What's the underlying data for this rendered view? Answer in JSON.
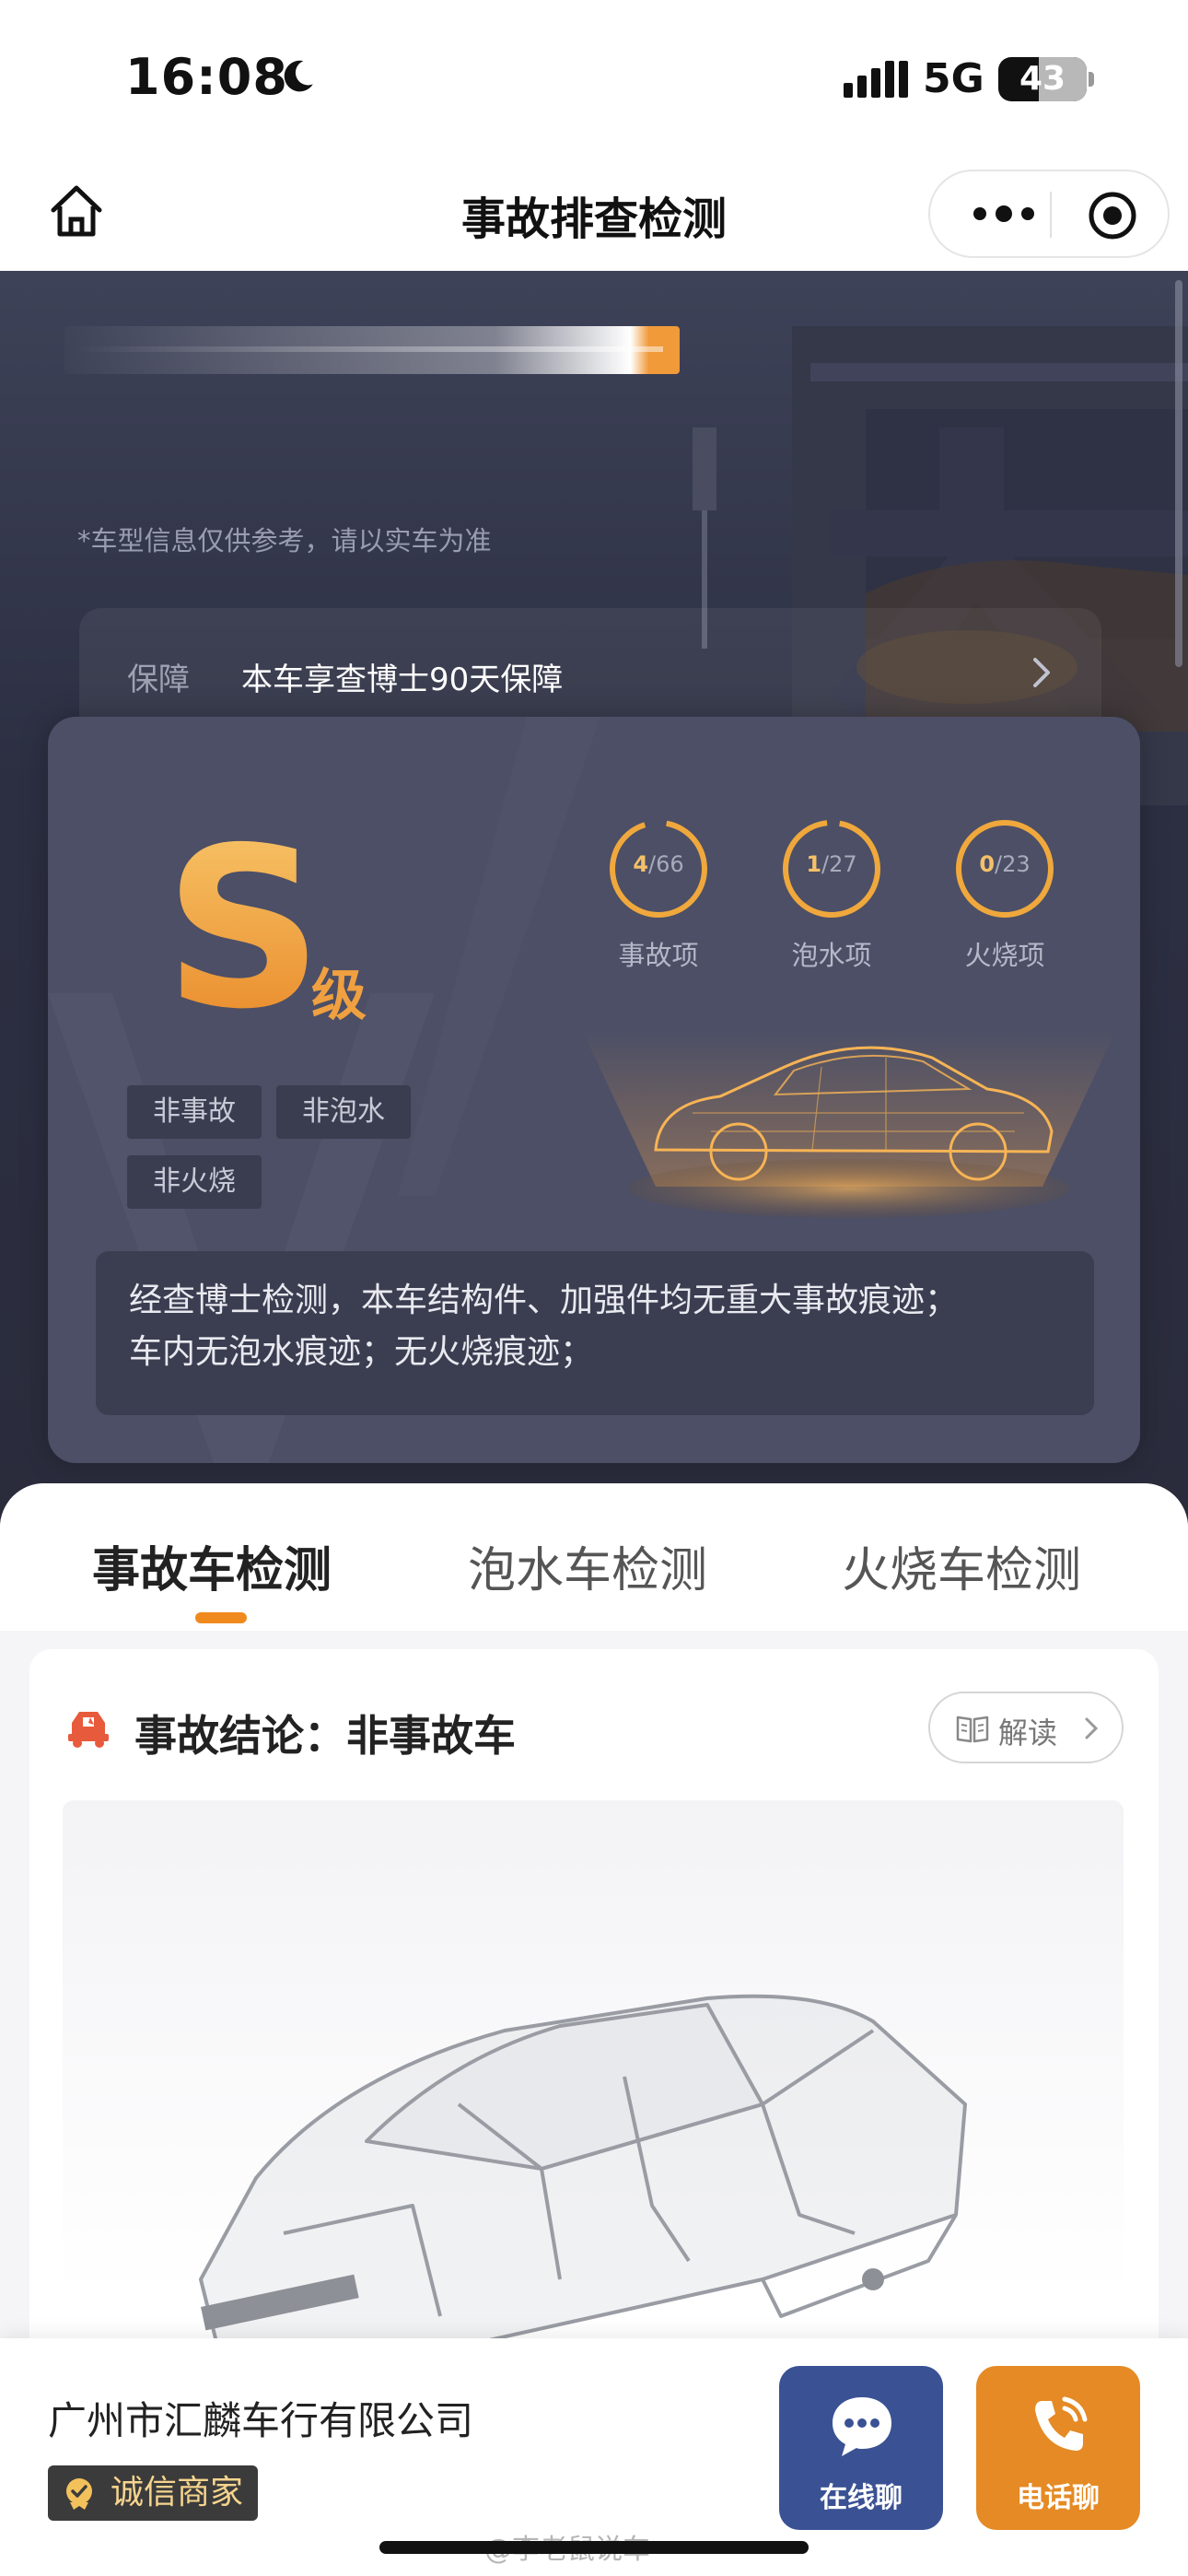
{
  "status_bar": {
    "time": "16:08",
    "network": "5G",
    "battery": "43"
  },
  "nav": {
    "title": "事故排查检测"
  },
  "hero": {
    "disclaimer": "*车型信息仅供参考，请以实车为准",
    "guarantee": {
      "label": "保障",
      "text": "本车享查博士90天保障"
    },
    "grade": {
      "letter": "S",
      "suffix": "级"
    },
    "tags": [
      "非事故",
      "非泡水",
      "非火烧"
    ],
    "stats": [
      {
        "count": "4",
        "total": "/66",
        "label": "事故项"
      },
      {
        "count": "1",
        "total": "/27",
        "label": "泡水项"
      },
      {
        "count": "0",
        "total": "/23",
        "label": "火烧项"
      }
    ],
    "summary_line1": "经查博士检测，本车结构件、加强件均无重大事故痕迹；",
    "summary_line2": "车内无泡水痕迹；无火烧痕迹；"
  },
  "tabs": [
    {
      "label": "事故车检测",
      "active": true
    },
    {
      "label": "泡水车检测",
      "active": false
    },
    {
      "label": "火烧车检测",
      "active": false
    }
  ],
  "result": {
    "title": "事故结论：非事故车",
    "read_label": "解读"
  },
  "bottom_bar": {
    "company": "广州市汇麟车行有限公司",
    "badge": "诚信商家",
    "chat_label": "在线聊",
    "call_label": "电话聊"
  },
  "watermark": "@李老鼠说车",
  "colors": {
    "accent": "#f08a1e",
    "chat_button": "#3a5294",
    "call_button": "#e58a24",
    "hero_bg": "#2c2f42"
  }
}
